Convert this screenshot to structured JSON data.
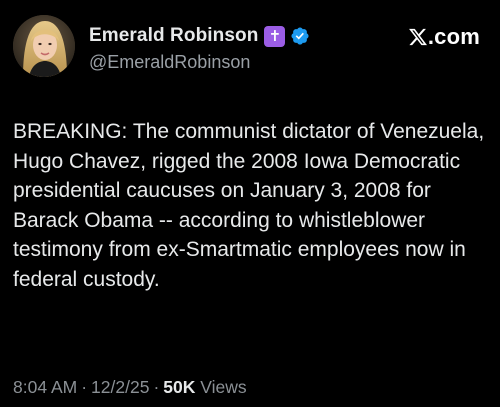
{
  "author": {
    "display_name": "Emerald Robinson",
    "badge_icon": "latin-cross-icon",
    "badge_glyph": "✝",
    "badge_color": "#9b5de5",
    "verified_color": "#1d9bf0",
    "handle": "@EmeraldRobinson"
  },
  "brand": {
    "logo_icon": "x-logo-icon",
    "domain": ".com"
  },
  "post": {
    "text": "BREAKING: The communist dictator of Venezuela, Hugo Chavez, rigged the 2008 Iowa Democratic presidential caucuses on January 3, 2008 for Barack Obama -- according to whistleblower testimony from ex-Smartmatic employees now in federal custody."
  },
  "meta": {
    "time": "8:04 AM",
    "separator": "·",
    "date": "12/2/25",
    "views_count": "50K",
    "views_label": "Views"
  }
}
